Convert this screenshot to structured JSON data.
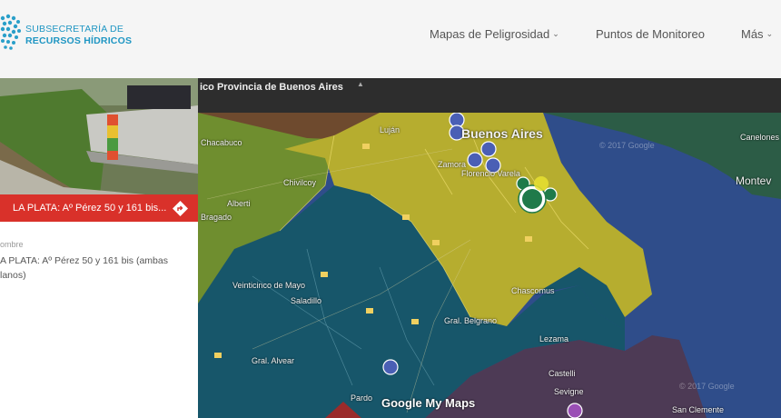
{
  "header": {
    "org_line1": "SUBSECRETARÍA DE",
    "org_line2": "RECURSOS HÍDRICOS",
    "logo_icon": "hydro-tree-logo",
    "nav": [
      {
        "label": "Mapas de Peligrosidad",
        "dropdown": true
      },
      {
        "label": "Puntos de Monitoreo",
        "dropdown": false
      },
      {
        "label": "Más",
        "dropdown": true
      }
    ]
  },
  "map": {
    "title": "ico Provincia de Buenos Aires",
    "brand": "Google My Maps",
    "watermark": "© 2017 Google",
    "labels": {
      "chacabuco": "Chacabuco",
      "lujan": "Luján",
      "buenos_aires": "Buenos Aires",
      "alberti": "Alberti",
      "chivilcoy": "Chivilcoy",
      "bragado": "Bragado",
      "veinticinco_de_mayo": "Veinticinco de Mayo",
      "saladillo": "Saladillo",
      "chascomus": "Chascomus",
      "gral_belgrano": "Gral. Belgrano",
      "lezama": "Lezama",
      "gral_alvear": "Gral. Alvear",
      "castelli": "Castelli",
      "sevigne": "Sevigne",
      "san_clemente": "San Clemente",
      "canelones": "Canelones",
      "montevideo": "Montev",
      "pardo": "Pardo",
      "zamora": "Zamora",
      "florencio_varela": "Florencio Varela"
    }
  },
  "detail": {
    "route_title": "LA PLATA: Aº Pérez 50 y 161 bis...",
    "field_label": "ombre",
    "field_value": "A PLATA: Aº Pérez 50 y 161 bis (ambas lanos)"
  },
  "colors": {
    "header_bg": "#f5f5f5",
    "brand_blue": "#1f96c3",
    "route_red": "#d9312a",
    "map_yellow": "#b6ad2f",
    "map_green": "#6f8e2f",
    "map_teal": "#17566a",
    "map_water": "#2f4d8a",
    "map_purple": "#4d3a55",
    "marker_blue": "#4a5fb5",
    "marker_green": "#1f7a4a"
  }
}
